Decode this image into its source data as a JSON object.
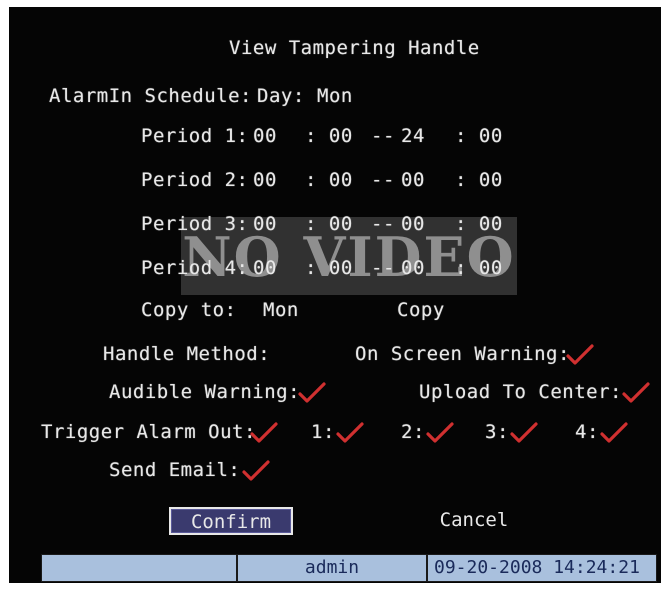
{
  "title": "View Tampering Handle",
  "schedule": {
    "label": "AlarmIn Schedule:",
    "day_label": "Day:",
    "day_value": "Mon"
  },
  "periods": [
    {
      "label": "Period 1:",
      "start_h": "00",
      "start_m": ": 00",
      "sep": "--",
      "end_h": "24",
      "end_m": ": 00"
    },
    {
      "label": "Period 2:",
      "start_h": "00",
      "start_m": ": 00",
      "sep": "--",
      "end_h": "00",
      "end_m": ": 00"
    },
    {
      "label": "Period 3:",
      "start_h": "00",
      "start_m": ": 00",
      "sep": "--",
      "end_h": "00",
      "end_m": ": 00"
    },
    {
      "label": "Period 4:",
      "start_h": "00",
      "start_m": ": 00",
      "sep": "--",
      "end_h": "00",
      "end_m": ": 00"
    }
  ],
  "copy": {
    "label": "Copy to:",
    "value": "Mon",
    "button": "Copy"
  },
  "handle": {
    "method_label": "Handle Method:",
    "on_screen_warning": "On Screen Warning:",
    "audible_warning": "Audible Warning:",
    "upload_to_center": "Upload To Center:",
    "trigger_alarm_out": "Trigger Alarm Out:",
    "outputs": [
      "1:",
      "2:",
      "3:",
      "4:"
    ],
    "send_email": "Send Email:"
  },
  "checks": {
    "on_screen_warning": true,
    "audible_warning": true,
    "upload_to_center": true,
    "trigger_alarm_out": true,
    "out_1": true,
    "out_2": true,
    "out_3": true,
    "out_4": true,
    "send_email": true
  },
  "overlay": {
    "no_video": "NO VIDEO"
  },
  "buttons": {
    "confirm": "Confirm",
    "cancel": "Cancel"
  },
  "status": {
    "user": "admin",
    "datetime": "09-20-2008 14:24:21"
  },
  "colors": {
    "background": "#050505",
    "text": "#e8e8e8",
    "check": "#d03030",
    "status_bar": "#a9c0dd",
    "confirm_focus": "#3a3a6e"
  },
  "icons": {
    "check": "check-icon"
  }
}
